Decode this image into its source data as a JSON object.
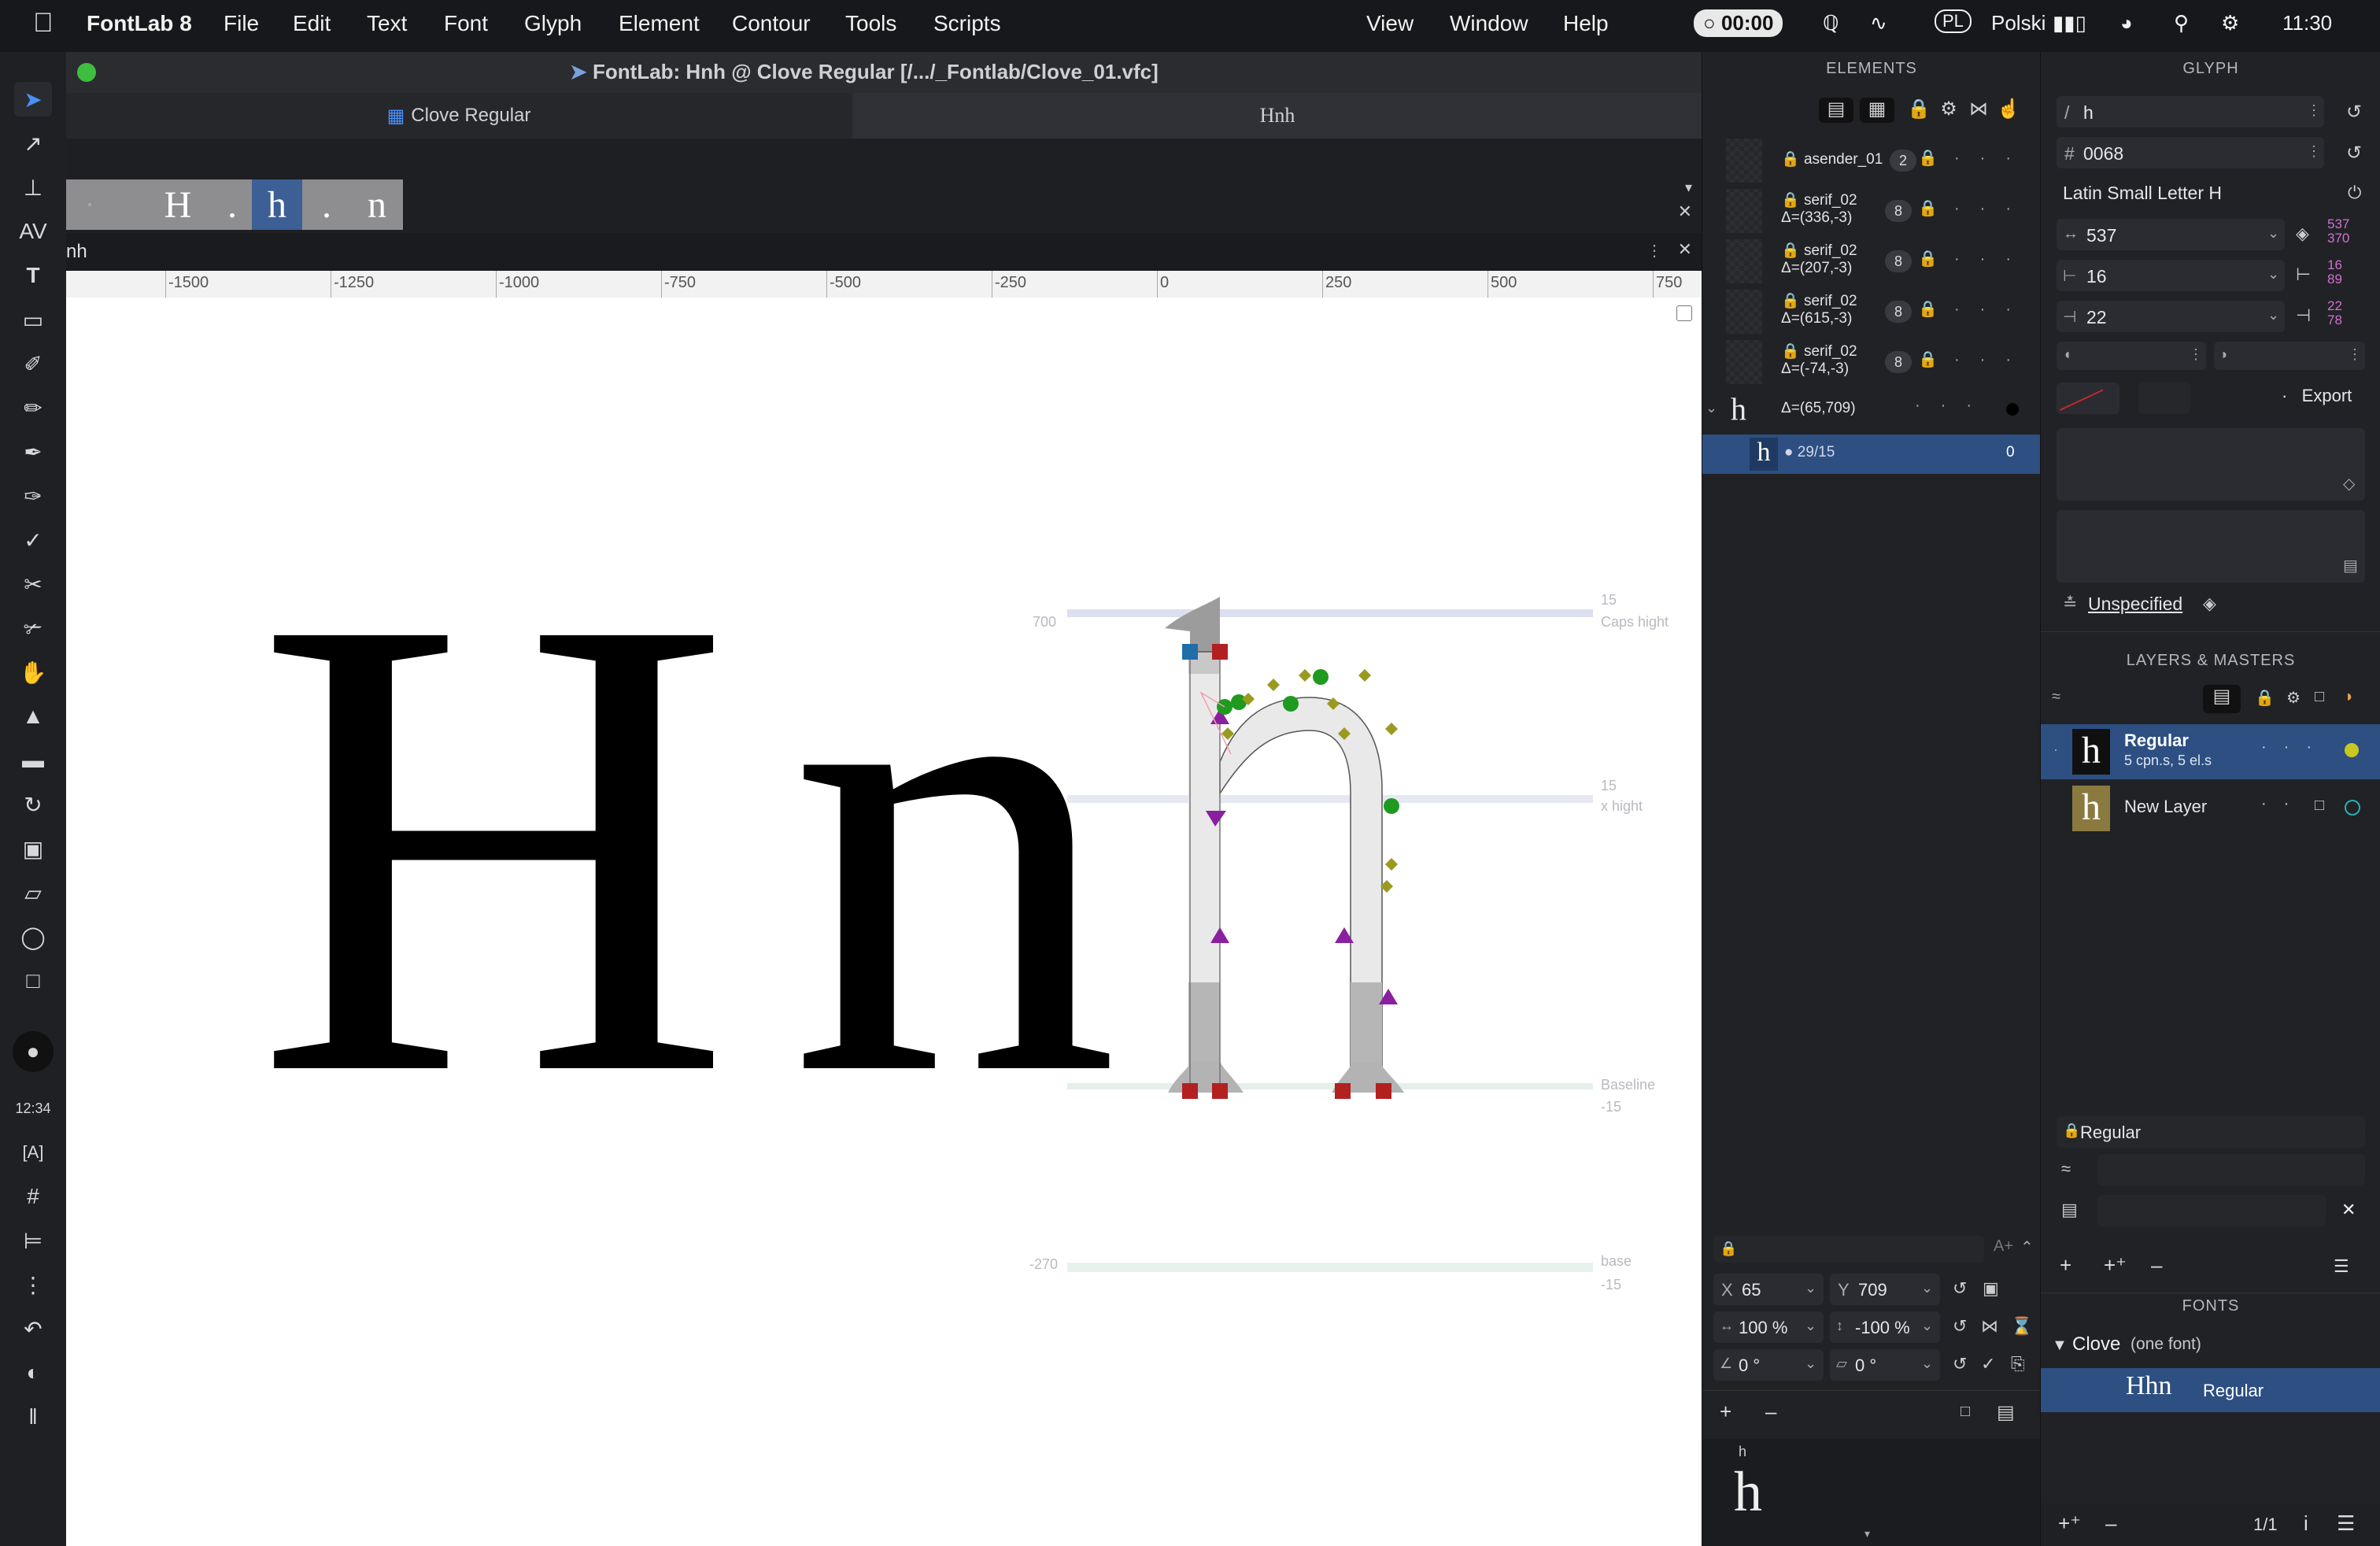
{
  "menubar": {
    "app_name": "FontLab 8",
    "menus": [
      "File",
      "Edit",
      "Text",
      "Font",
      "Glyph",
      "Element",
      "Contour",
      "Tools",
      "Scripts",
      "View",
      "Window",
      "Help"
    ],
    "timer": "00:00",
    "input_source": "PL",
    "input_label": "Polski",
    "clock": "11:30"
  },
  "window": {
    "title": "FontLab: Hnh @ Clove Regular [/.../_Fontlab/Clove_01.vfc]",
    "tab_font": "Clove Regular",
    "tab_text": "Hnh",
    "glyph_strip": [
      "H",
      ".",
      "h",
      ".",
      "n"
    ],
    "text_line": "nh"
  },
  "ruler": {
    "labels": [
      "-1500",
      "-1250",
      "-1000",
      "-750",
      "-500",
      "-250",
      "0",
      "250",
      "500",
      "750"
    ]
  },
  "canvas": {
    "glyphs_text": [
      "H",
      "n",
      "h"
    ],
    "metrics": {
      "caps_value": "700",
      "caps_offset": "15",
      "caps_label": "Caps hight",
      "xh_offset": "15",
      "xh_label": "x hight",
      "baseline_label": "Baseline",
      "baseline_offset": "-15",
      "desc_value": "-270",
      "desc_label": "base",
      "desc_offset": "-15"
    }
  },
  "elements_panel": {
    "title": "ELEMENTS",
    "rows": [
      {
        "name": "asender_01",
        "delta": "",
        "badge": "2"
      },
      {
        "name": "serif_02",
        "delta": "Δ=(336,-3)",
        "badge": "8"
      },
      {
        "name": "serif_02",
        "delta": "Δ=(207,-3)",
        "badge": "8"
      },
      {
        "name": "serif_02",
        "delta": "Δ=(615,-3)",
        "badge": "8"
      },
      {
        "name": "serif_02",
        "delta": "Δ=(-74,-3)",
        "badge": "8"
      }
    ],
    "group_row": {
      "glyph": "h",
      "delta": "Δ=(65,709)"
    },
    "selected_row": {
      "glyph": "h",
      "label": "29/15",
      "count": "0"
    },
    "transform": {
      "x_label": "X",
      "x_value": "65",
      "y_label": "Y",
      "y_value": "709",
      "scale_x": "100 %",
      "scale_y": "-100 %",
      "rotate": "0 °",
      "slant": "0 °"
    },
    "preview_name": "h",
    "preview_glyph": "h"
  },
  "glyph_panel": {
    "title": "GLYPH",
    "name_prefix": "/",
    "glyph_name": "h",
    "unicode_prefix": "#",
    "unicode": "0068",
    "description": "Latin Small Letter H",
    "advance": "537",
    "advance_calc_top": "537",
    "advance_calc_bottom": "370",
    "lsb": "16",
    "lsb_calc_top": "16",
    "lsb_calc_bottom": "89",
    "rsb": "22",
    "rsb_calc_top": "22",
    "rsb_calc_bottom": "78",
    "export_label": "Export",
    "tag_label": "Unspecified",
    "layers_title": "LAYERS & MASTERS",
    "layers": [
      {
        "name": "Regular",
        "detail": "5 cpn.s, 5 el.s",
        "color": "#c8c820"
      },
      {
        "name": "New Layer",
        "detail": "",
        "color": "#2ab0b0"
      }
    ],
    "layer_property_name": "Regular",
    "fonts_title": "FONTS",
    "font_family": "Clove",
    "font_family_note": "(one font)",
    "font_sample": "Hhn",
    "font_style": "Regular",
    "page_counter": "1/1"
  },
  "colors": {
    "accent": "#2f6fe0",
    "selection": "#2d4f82",
    "node_red": "#b32020",
    "node_blue": "#1f6ea8",
    "node_green": "#1f9a1f",
    "handle_olive": "#9a9a20",
    "tangent_purple": "#8a1fa0"
  }
}
